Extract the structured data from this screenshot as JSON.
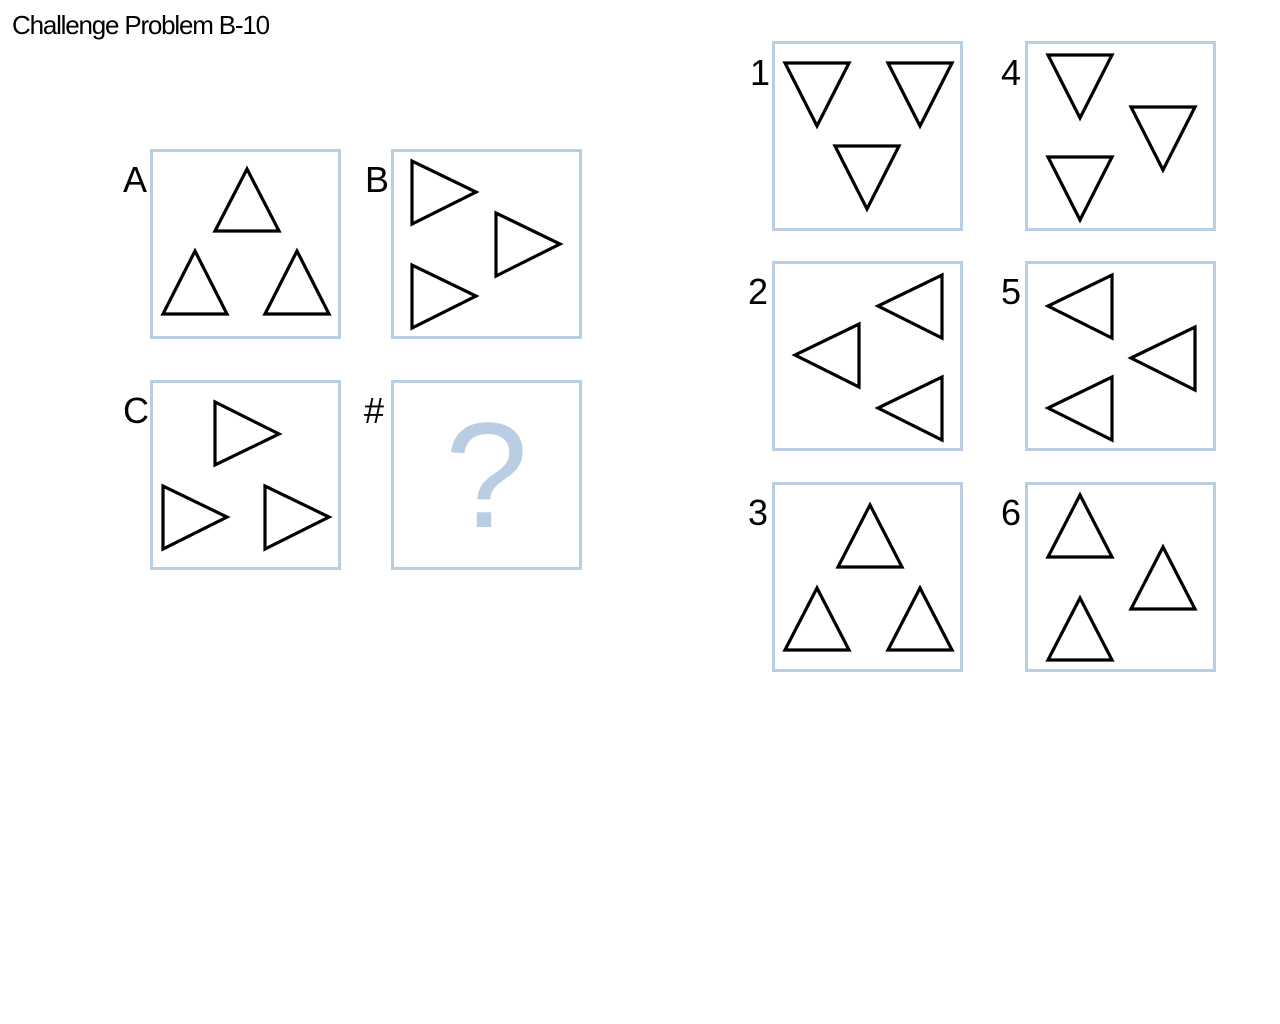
{
  "page": {
    "title": "Challenge Problem B-10"
  },
  "colors": {
    "panel_border": "#b9cde3",
    "shape_stroke": "#000000",
    "question_mark": "#b9cde3"
  },
  "matrix": {
    "cells": [
      {
        "label": "A",
        "shape": "triangle",
        "orientation": "up",
        "count": 3
      },
      {
        "label": "B",
        "shape": "triangle",
        "orientation": "right",
        "count": 3
      },
      {
        "label": "C",
        "shape": "triangle",
        "orientation": "right",
        "count": 3
      },
      {
        "label": "#",
        "placeholder": "?"
      }
    ]
  },
  "options": [
    {
      "label": "1",
      "shape": "triangle",
      "orientation": "down",
      "count": 3
    },
    {
      "label": "2",
      "shape": "triangle",
      "orientation": "left",
      "count": 3
    },
    {
      "label": "3",
      "shape": "triangle",
      "orientation": "up",
      "count": 3
    },
    {
      "label": "4",
      "shape": "triangle",
      "orientation": "down",
      "count": 3
    },
    {
      "label": "5",
      "shape": "triangle",
      "orientation": "left",
      "count": 3
    },
    {
      "label": "6",
      "shape": "triangle",
      "orientation": "up",
      "count": 3
    }
  ]
}
